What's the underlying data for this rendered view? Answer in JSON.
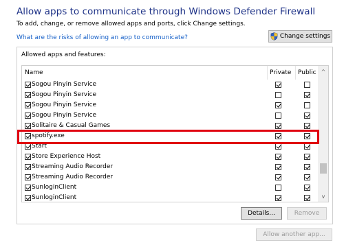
{
  "header": {
    "title": "Allow apps to communicate through Windows Defender Firewall",
    "subtitle": "To add, change, or remove allowed apps and ports, click Change settings.",
    "risk_link": "What are the risks of allowing an app to communicate?",
    "change_settings_label": "Change settings",
    "change_settings_icon": "uac-shield-icon"
  },
  "group": {
    "label": "Allowed apps and features:"
  },
  "columns": {
    "name": "Name",
    "private": "Private",
    "public": "Public"
  },
  "apps": [
    {
      "name": "Sogou Pinyin Service",
      "enabled": true,
      "private": true,
      "public": false
    },
    {
      "name": "Sogou Pinyin Service",
      "enabled": true,
      "private": false,
      "public": true
    },
    {
      "name": "Sogou Pinyin Service",
      "enabled": true,
      "private": true,
      "public": false
    },
    {
      "name": "Sogou Pinyin Service",
      "enabled": true,
      "private": false,
      "public": true
    },
    {
      "name": "Solitaire & Casual Games",
      "enabled": true,
      "private": true,
      "public": true
    },
    {
      "name": "spotify.exe",
      "enabled": true,
      "private": true,
      "public": true
    },
    {
      "name": "Start",
      "enabled": true,
      "private": true,
      "public": true
    },
    {
      "name": "Store Experience Host",
      "enabled": true,
      "private": true,
      "public": true
    },
    {
      "name": "Streaming Audio Recorder",
      "enabled": true,
      "private": true,
      "public": true
    },
    {
      "name": "Streaming Audio Recorder",
      "enabled": true,
      "private": true,
      "public": true
    },
    {
      "name": "SunloginClient",
      "enabled": true,
      "private": false,
      "public": true
    },
    {
      "name": "SunloginClient",
      "enabled": true,
      "private": true,
      "public": true
    }
  ],
  "buttons": {
    "details": "Details...",
    "remove": "Remove",
    "allow_another": "Allow another app..."
  },
  "scrollbar": {
    "up_glyph": "^",
    "down_glyph": "v"
  },
  "colors": {
    "title": "#1e3287",
    "link": "#1660c8",
    "highlight": "#e0000f"
  }
}
